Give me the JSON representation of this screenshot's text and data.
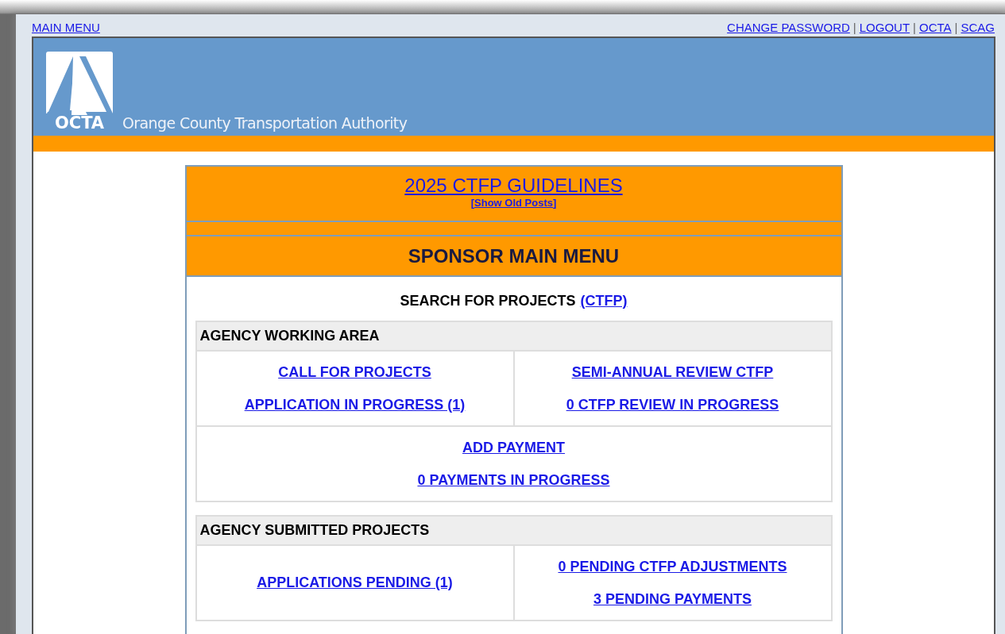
{
  "top_nav": {
    "main_link": "MAIN MENU",
    "links": [
      {
        "kind": "link",
        "text": "CHANGE PASSWORD"
      },
      {
        "kind": "separator",
        "text": "|"
      },
      {
        "kind": "link",
        "text": "LOGOUT"
      },
      {
        "kind": "separator",
        "text": "|"
      },
      {
        "kind": "link",
        "text": "OCTA"
      },
      {
        "kind": "separator",
        "text": "|"
      },
      {
        "kind": "link",
        "text": "SCAG"
      }
    ]
  },
  "header": {
    "logo_text": "OCTA",
    "org_name": "Orange County Transportation Authority"
  },
  "announcement": {
    "title": "2025 CTFP GUIDELINES",
    "old_posts": "Show Old Posts",
    "bracket_open": "[",
    "bracket_close": "]"
  },
  "menu_title": "SPONSOR MAIN MENU",
  "search": {
    "label": "SEARCH FOR PROJECTS",
    "link": "(CTFP)"
  },
  "sections": [
    {
      "title": "AGENCY WORKING AREA",
      "rows": [
        {
          "cells": [
            [
              "CALL FOR PROJECTS",
              "APPLICATION IN PROGRESS (1)"
            ],
            [
              "SEMI-ANNUAL REVIEW CTFP",
              "0 CTFP REVIEW IN PROGRESS"
            ]
          ]
        },
        {
          "cells": [
            [
              "ADD PAYMENT",
              "0 PAYMENTS IN PROGRESS"
            ]
          ]
        }
      ]
    },
    {
      "title": "AGENCY SUBMITTED PROJECTS",
      "rows": [
        {
          "cells": [
            [
              "APPLICATIONS PENDING (1)"
            ],
            [
              "0 PENDING CTFP ADJUSTMENTS",
              "3 PENDING PAYMENTS"
            ]
          ]
        }
      ]
    }
  ]
}
